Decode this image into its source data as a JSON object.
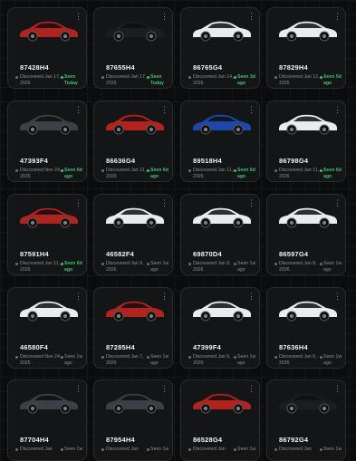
{
  "colors": {
    "red": "#b0231f",
    "black": "#1c1d20",
    "white": "#e9ecef",
    "gray": "#3c3f45",
    "blue": "#1f47a8",
    "seen_recent": "#3ec26e"
  },
  "cards": [
    {
      "vin": "87428H4",
      "color": "red",
      "discovered": "Discovered Jan 17, 2026",
      "seen": "Seen Today",
      "recent": true
    },
    {
      "vin": "87655H4",
      "color": "black",
      "discovered": "Discovered Jan 17, 2026",
      "seen": "Seen Today",
      "recent": true
    },
    {
      "vin": "86765G4",
      "color": "white",
      "discovered": "Discovered Jan 14, 2026",
      "seen": "Seen 3d ago",
      "recent": true
    },
    {
      "vin": "87829H4",
      "color": "white",
      "discovered": "Discovered Jan 12, 2026",
      "seen": "Seen 5d ago",
      "recent": true
    },
    {
      "vin": "47393F4",
      "color": "gray",
      "discovered": "Discovered Nov 24, 2025",
      "seen": "Seen 6d ago",
      "recent": true
    },
    {
      "vin": "86636G4",
      "color": "red",
      "discovered": "Discovered Jan 11, 2026",
      "seen": "Seen 6d ago",
      "recent": true
    },
    {
      "vin": "89518H4",
      "color": "blue",
      "discovered": "Discovered Jan 11, 2026",
      "seen": "Seen 6d ago",
      "recent": true
    },
    {
      "vin": "86798G4",
      "color": "white",
      "discovered": "Discovered Jan 11, 2026",
      "seen": "Seen 6d ago",
      "recent": true
    },
    {
      "vin": "87591H4",
      "color": "red",
      "discovered": "Discovered Jan 11, 2026",
      "seen": "Seen 6d ago",
      "recent": true
    },
    {
      "vin": "46582F4",
      "color": "white",
      "discovered": "Discovered Jan 9, 2026",
      "seen": "Seen 1w ago",
      "recent": false
    },
    {
      "vin": "69870D4",
      "color": "white",
      "discovered": "Discovered Jan 8, 2026",
      "seen": "Seen 1w ago",
      "recent": false
    },
    {
      "vin": "86597G4",
      "color": "white",
      "discovered": "Discovered Jan 8, 2026",
      "seen": "Seen 1w ago",
      "recent": false
    },
    {
      "vin": "46580F4",
      "color": "white",
      "discovered": "Discovered Nov 24, 2025",
      "seen": "Seen 1w ago",
      "recent": false
    },
    {
      "vin": "87285H4",
      "color": "red",
      "discovered": "Discovered Jan 7, 2026",
      "seen": "Seen 1w ago",
      "recent": false
    },
    {
      "vin": "47399F4",
      "color": "white",
      "discovered": "Discovered Jan 6, 2026",
      "seen": "Seen 1w ago",
      "recent": false
    },
    {
      "vin": "87636H4",
      "color": "white",
      "discovered": "Discovered Jan 6, 2026",
      "seen": "Seen 1w ago",
      "recent": false
    },
    {
      "vin": "87704H4",
      "color": "gray",
      "discovered": "Discovered Jan",
      "seen": "Seen 1w",
      "recent": false
    },
    {
      "vin": "87954H4",
      "color": "gray",
      "discovered": "Discovered Jan",
      "seen": "Seen 1w",
      "recent": false
    },
    {
      "vin": "86528G4",
      "color": "red",
      "discovered": "Discovered Jan",
      "seen": "Seen 1w",
      "recent": false
    },
    {
      "vin": "86792G4",
      "color": "black",
      "discovered": "Discovered Jan",
      "seen": "Seen 1w",
      "recent": false
    }
  ],
  "menu_icon": "more-vertical-icon"
}
